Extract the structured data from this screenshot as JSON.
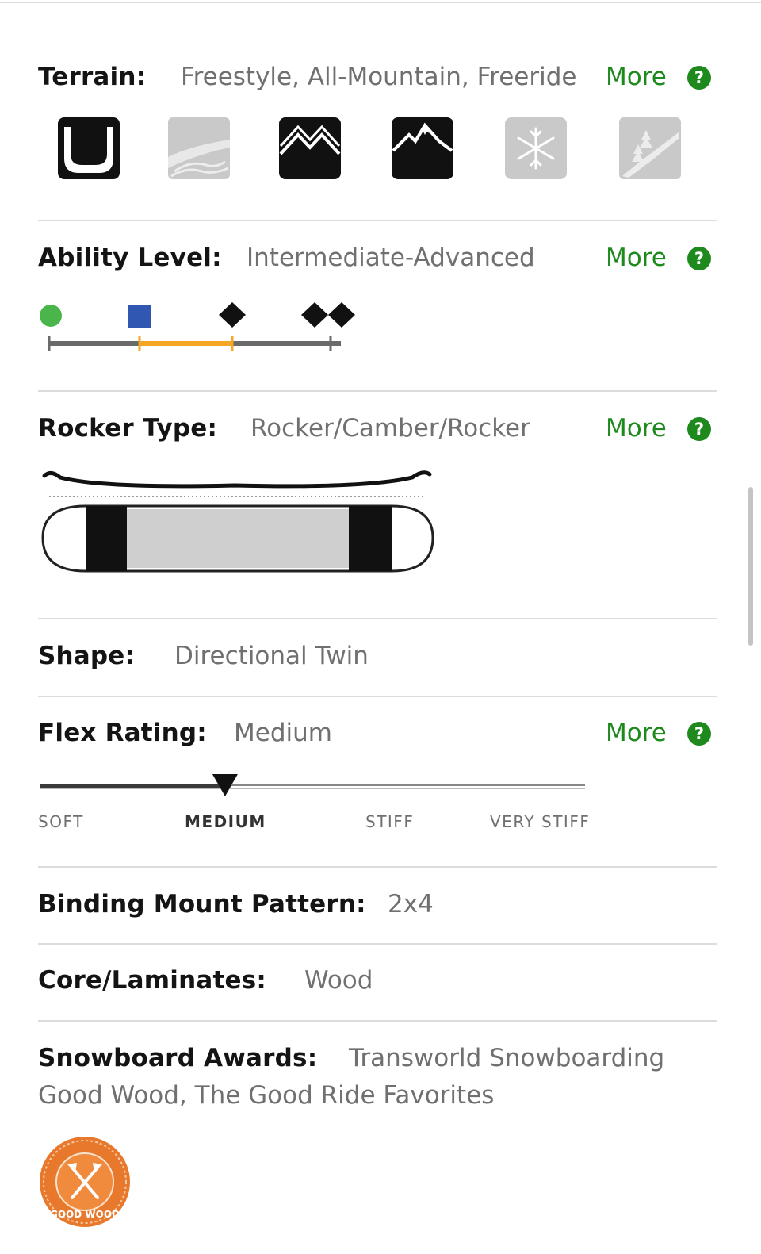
{
  "specs": {
    "terrain": {
      "label": "Terrain:",
      "value": "Freestyle, All-Mountain, Freeride",
      "more": "More",
      "help": "?",
      "icons": [
        {
          "name": "park-halfpipe-icon",
          "active": true
        },
        {
          "name": "powder-icon",
          "active": false
        },
        {
          "name": "all-mountain-icon",
          "active": true
        },
        {
          "name": "freeride-peak-icon",
          "active": true
        },
        {
          "name": "snowflake-icon",
          "active": false
        },
        {
          "name": "backcountry-icon",
          "active": false
        }
      ]
    },
    "ability": {
      "label": "Ability Level:",
      "value": "Intermediate-Advanced",
      "more": "More",
      "help": "?",
      "levels": [
        "green-circle-icon",
        "blue-square-icon",
        "black-diamond-icon",
        "double-black-diamond-icon"
      ],
      "highlighted_range": [
        1,
        2
      ],
      "colors": {
        "green": "#49b54a",
        "blue": "#3057b1",
        "black": "#111111",
        "highlight": "#f5a623",
        "track": "#6a6a6a"
      }
    },
    "rocker": {
      "label": "Rocker Type:",
      "value": "Rocker/Camber/Rocker",
      "more": "More",
      "help": "?"
    },
    "shape": {
      "label": "Shape:",
      "value": "Directional Twin"
    },
    "flex": {
      "label": "Flex Rating:",
      "value": "Medium",
      "more": "More",
      "help": "?",
      "ticks": [
        "SOFT",
        "MEDIUM",
        "STIFF",
        "VERY STIFF"
      ],
      "level": 0.34
    },
    "binding": {
      "label": "Binding Mount Pattern:",
      "value": "2x4"
    },
    "core": {
      "label": "Core/Laminates:",
      "value": "Wood"
    },
    "awards": {
      "label": "Snowboard Awards:",
      "value_line1": "Transworld Snowboarding",
      "value_line2": "Good Wood, The Good Ride Favorites",
      "badge": {
        "name": "good-wood-award-badge",
        "text": "GOOD WOOD",
        "color": "#e8792c"
      }
    }
  },
  "accent_color": "#1e8a1e"
}
